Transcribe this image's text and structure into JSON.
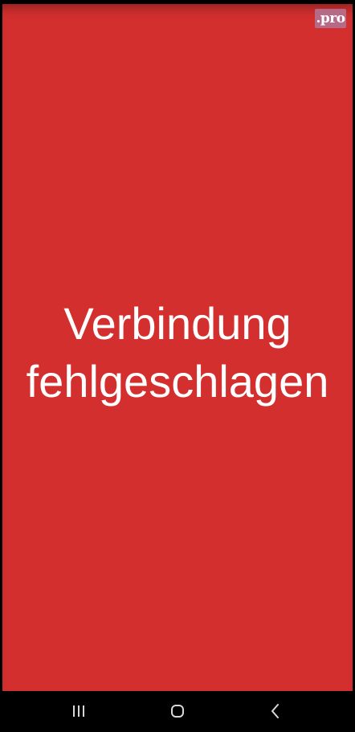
{
  "badge": {
    "label": ".pro"
  },
  "error": {
    "line1": "Verbindung",
    "line2": "fehlgeschlagen",
    "background_color": "#d32f2f",
    "text_color": "#ffffff"
  },
  "navigation": {
    "buttons": [
      {
        "name": "recents",
        "icon": "recents-icon"
      },
      {
        "name": "home",
        "icon": "home-icon"
      },
      {
        "name": "back",
        "icon": "back-icon"
      }
    ]
  }
}
